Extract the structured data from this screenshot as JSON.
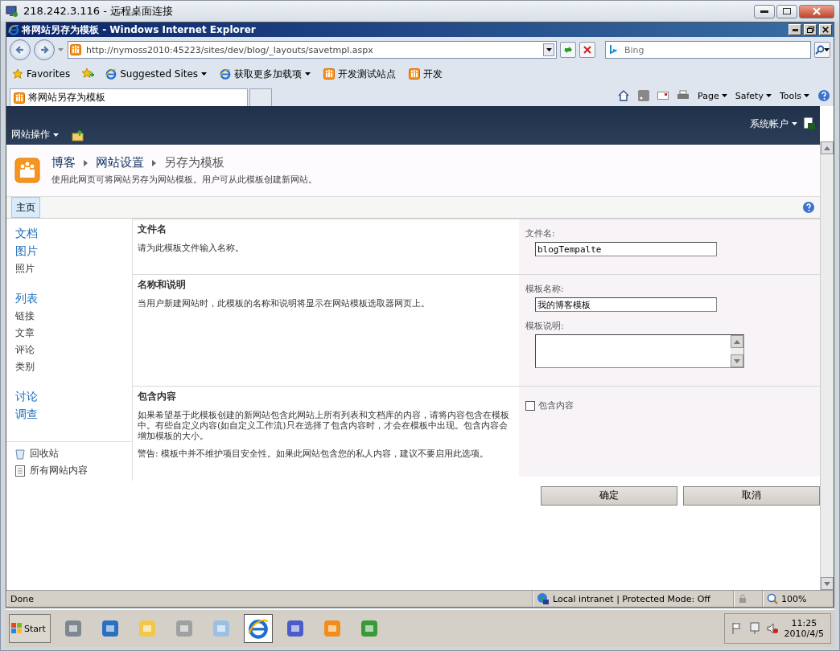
{
  "remote_window": {
    "title": "218.242.3.116 - 远程桌面连接"
  },
  "browser": {
    "title": "将网站另存为模板 - Windows Internet Explorer",
    "address": {
      "url": "http://nymoss2010:45223/sites/dev/blog/_layouts/savetmpl.aspx"
    },
    "search": {
      "placeholder": "Bing"
    },
    "favorites": {
      "label": "Favorites",
      "items": [
        {
          "label": "Suggested Sites",
          "kind": "ie",
          "dropdown": true
        },
        {
          "label": "获取更多加载项",
          "kind": "ie",
          "dropdown": true
        },
        {
          "label": "开发测试站点",
          "kind": "site",
          "dropdown": false
        },
        {
          "label": "开发",
          "kind": "site",
          "dropdown": false
        }
      ]
    },
    "tab": {
      "title": "将网站另存为模板"
    },
    "commands": [
      {
        "label": "Page"
      },
      {
        "label": "Safety"
      },
      {
        "label": "Tools"
      }
    ]
  },
  "site": {
    "site_actions": "网站操作",
    "user": "系统帐户",
    "breadcrumb": [
      {
        "label": "博客",
        "kind": "link"
      },
      {
        "label": "网站设置",
        "kind": "link"
      },
      {
        "label": "另存为模板",
        "kind": "current"
      }
    ],
    "description": "使用此网页可将网站另存为网站模板。用户可从此模板创建新网站。",
    "top_nav": [
      {
        "label": "主页",
        "selected": true
      }
    ],
    "quick_launch": [
      {
        "label": "文档",
        "kind": "heading"
      },
      {
        "label": "图片",
        "kind": "heading"
      },
      {
        "label": "照片",
        "kind": "item"
      },
      {
        "label": "列表",
        "kind": "heading"
      },
      {
        "label": "链接",
        "kind": "item"
      },
      {
        "label": "文章",
        "kind": "item"
      },
      {
        "label": "评论",
        "kind": "item"
      },
      {
        "label": "类别",
        "kind": "item"
      },
      {
        "label": "讨论",
        "kind": "heading"
      },
      {
        "label": "调查",
        "kind": "heading"
      }
    ],
    "quick_launch_footer": [
      {
        "label": "回收站",
        "kind": "recycle"
      },
      {
        "label": "所有网站内容",
        "kind": "content"
      }
    ],
    "sections": [
      {
        "title": "文件名",
        "paragraphs": [
          "请为此模板文件输入名称。"
        ],
        "fields": [
          {
            "kind": "text",
            "label": "文件名:",
            "value": "blogTempalte"
          }
        ]
      },
      {
        "title": "名称和说明",
        "paragraphs": [
          "当用户新建网站时，此模板的名称和说明将显示在网站模板选取器网页上。"
        ],
        "fields": [
          {
            "kind": "text",
            "label": "模板名称:",
            "value": "我的博客模板"
          },
          {
            "kind": "textarea",
            "label": "模板说明:"
          }
        ]
      },
      {
        "title": "包含内容",
        "paragraphs": [
          "如果希望基于此模板创建的新网站包含此网站上所有列表和文档库的内容，请将内容包含在模板中。有些自定义内容(如自定义工作流)只在选择了包含内容时，才会在模板中出现。包含内容会增加模板的大小。",
          "警告: 模板中并不维护项目安全性。如果此网站包含您的私人内容，建议不要启用此选项。"
        ],
        "fields": [
          {
            "kind": "checkbox",
            "label": "包含内容",
            "checked": false
          }
        ]
      }
    ],
    "buttons": [
      "确定",
      "取消"
    ]
  },
  "status_bar": {
    "text": "Done",
    "zone": "Local intranet | Protected Mode: Off",
    "zoom": "100%"
  },
  "taskbar": {
    "start": "Start",
    "apps": [
      {
        "selected": false
      },
      {
        "selected": false
      },
      {
        "selected": false
      },
      {
        "selected": false
      },
      {
        "selected": false
      },
      {
        "selected": true
      },
      {
        "selected": false
      },
      {
        "selected": false
      },
      {
        "selected": false
      }
    ],
    "clock": {
      "time": "11:25",
      "date": "2010/4/5"
    }
  }
}
